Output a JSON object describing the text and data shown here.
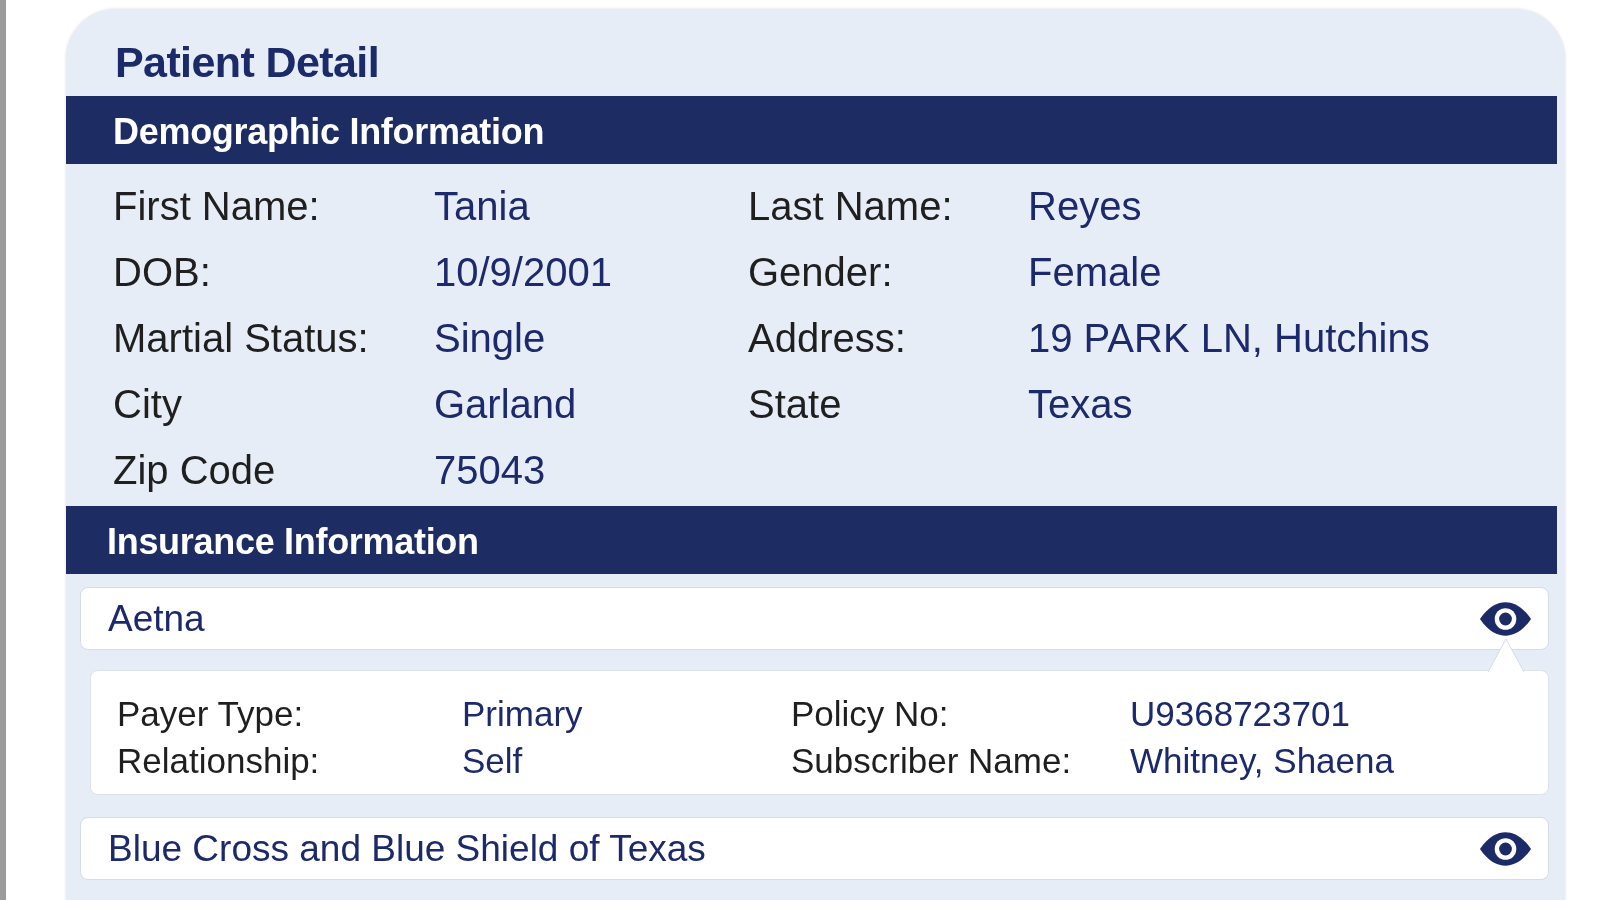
{
  "title": "Patient Detail",
  "demographics": {
    "heading": "Demographic Information",
    "fields": [
      {
        "label": "First Name:",
        "value": "Tania"
      },
      {
        "label": "Last Name:",
        "value": "Reyes"
      },
      {
        "label": "DOB:",
        "value": "10/9/2001"
      },
      {
        "label": "Gender:",
        "value": "Female"
      },
      {
        "label": "Martial Status:",
        "value": "Single"
      },
      {
        "label": "Address:",
        "value": "19 PARK LN, Hutchins"
      },
      {
        "label": "City",
        "value": "Garland"
      },
      {
        "label": "State",
        "value": "Texas"
      },
      {
        "label": "Zip Code",
        "value": "75043"
      }
    ]
  },
  "insurance": {
    "heading": "Insurance Information",
    "payers": [
      {
        "name": "Aetna",
        "expanded": true,
        "details": [
          {
            "label": "Payer Type:",
            "value": "Primary"
          },
          {
            "label": "Policy No:",
            "value": "U9368723701"
          },
          {
            "label": "Relationship:",
            "value": "Self"
          },
          {
            "label": "Subscriber Name:",
            "value": "Whitney, Shaena"
          }
        ]
      },
      {
        "name": "Blue Cross and Blue Shield of Texas",
        "expanded": false
      }
    ]
  }
}
